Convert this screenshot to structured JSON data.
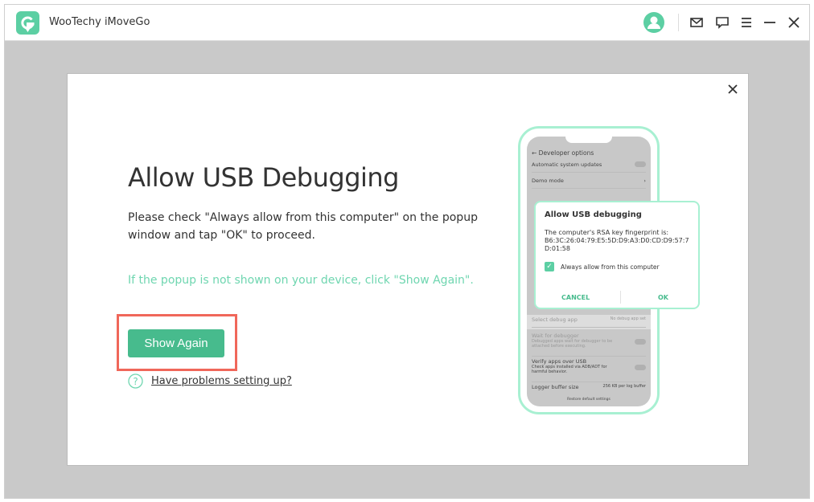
{
  "app": {
    "title": "WooTechy iMoveGo"
  },
  "titlebar": {
    "icons": [
      "user-avatar-icon",
      "mail-icon",
      "feedback-icon",
      "menu-icon",
      "minimize-icon",
      "close-icon"
    ]
  },
  "modal": {
    "title": "Allow USB Debugging",
    "description": "Please check \"Always allow from this computer\" on the popup window and tap \"OK\" to proceed.",
    "hint": "If the popup is not shown on your device, click \"Show Again\".",
    "show_again_label": "Show Again",
    "help_link": "Have problems setting up?"
  },
  "phone": {
    "header": "Developer options",
    "rows": [
      {
        "label": "Automatic system updates"
      },
      {
        "label": "Demo mode"
      },
      {
        "label": "Select debug app",
        "value": "No debug app set"
      },
      {
        "label": "Wait for debugger",
        "sub": "Debugged apps wait for debugger to be attached before executing."
      },
      {
        "label": "Verify apps over USB",
        "sub": "Check apps installed via ADB/ADT for harmful behavior."
      },
      {
        "label": "Logger buffer size",
        "value": "256 KB per log buffer"
      }
    ],
    "footer": "Restore default settings",
    "dialog": {
      "title": "Allow USB debugging",
      "fingerprint_label": "The computer's RSA key fingerprint is:",
      "fingerprint": "B6:3C:26:04:79:E5:5D:D9:A3:D0:CD:D9:57:7D:01:58",
      "checkbox_label": "Always allow from this computer",
      "checked": true,
      "cancel": "CANCEL",
      "ok": "OK"
    }
  },
  "colors": {
    "accent": "#47bb8d",
    "hint": "#6fd6b0",
    "highlight": "#f0675a",
    "phone_frame": "#a8f0d2"
  }
}
